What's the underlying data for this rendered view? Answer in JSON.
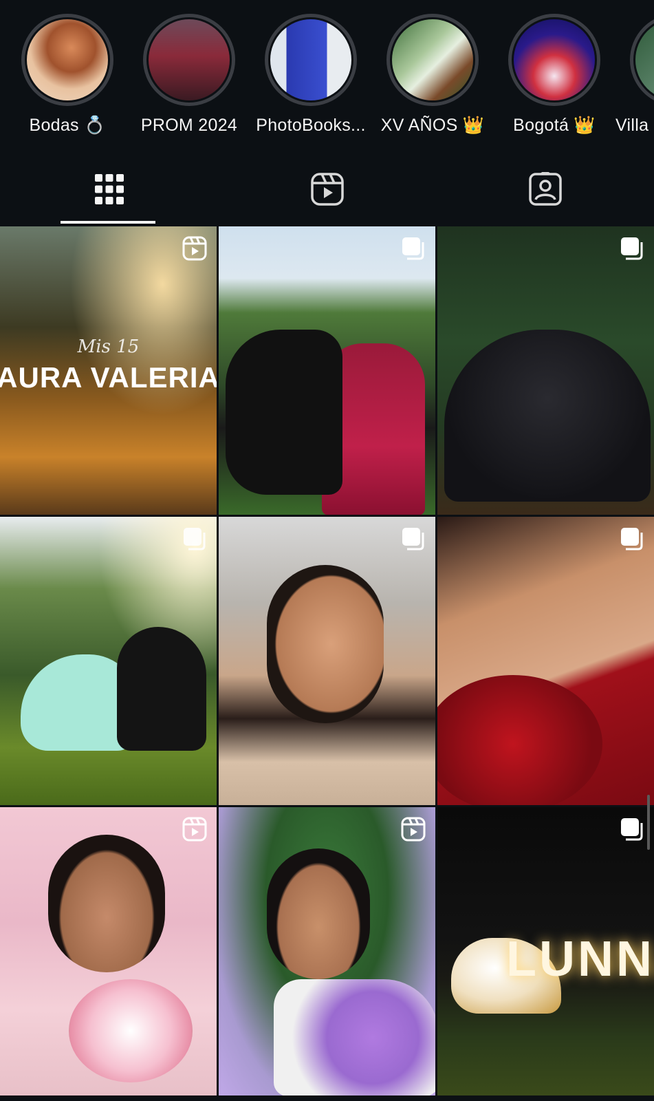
{
  "highlights": [
    {
      "label": "Bodas 💍"
    },
    {
      "label": "PROM 2024"
    },
    {
      "label": "PhotoBooks..."
    },
    {
      "label": "XV AÑOS 👑"
    },
    {
      "label": "Bogotá 👑"
    },
    {
      "label": "Villa"
    }
  ],
  "tabs": [
    {
      "icon": "grid-icon",
      "active": true
    },
    {
      "icon": "reels-icon",
      "active": false
    },
    {
      "icon": "tagged-icon",
      "active": false
    }
  ],
  "posts": [
    {
      "badge": "reel-icon",
      "overlay_small": "Mis 15",
      "overlay_big": "AURA VALERIA"
    },
    {
      "badge": "carousel-icon"
    },
    {
      "badge": "carousel-icon"
    },
    {
      "badge": "carousel-icon"
    },
    {
      "badge": "carousel-icon"
    },
    {
      "badge": "carousel-icon"
    },
    {
      "badge": "reel-icon"
    },
    {
      "badge": "reel-icon"
    },
    {
      "badge": "carousel-icon",
      "overlay_big": "LUNNA"
    }
  ],
  "colors": {
    "background": "#0c1014",
    "text": "#f5f5f5",
    "ring": "#3b3e44"
  }
}
